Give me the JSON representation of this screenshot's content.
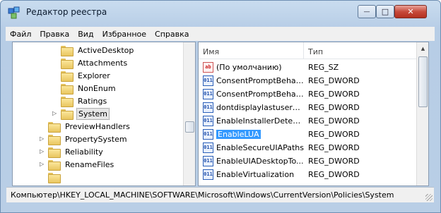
{
  "window": {
    "title": "Редактор реестра",
    "controls": {
      "minimize": "—",
      "maximize": "□",
      "close": "✕"
    }
  },
  "menu": [
    "Файл",
    "Правка",
    "Вид",
    "Избранное",
    "Справка"
  ],
  "tree": {
    "items": [
      {
        "label": "ActiveDesktop",
        "level": 2
      },
      {
        "label": "Attachments",
        "level": 2
      },
      {
        "label": "Explorer",
        "level": 2
      },
      {
        "label": "NonEnum",
        "level": 2
      },
      {
        "label": "Ratings",
        "level": 2
      },
      {
        "label": "System",
        "level": 2,
        "selected": true,
        "expander": "▷"
      },
      {
        "label": "PreviewHandlers",
        "level": 1
      },
      {
        "label": "PropertySystem",
        "level": 1,
        "expander": "▷"
      },
      {
        "label": "Reliability",
        "level": 1,
        "expander": "▷"
      },
      {
        "label": "RenameFiles",
        "level": 1,
        "expander": "▷"
      }
    ]
  },
  "list": {
    "columns": {
      "name": "Имя",
      "type": "Тип"
    },
    "rows": [
      {
        "icon": "ab",
        "name": "(По умолчанию)",
        "type": "REG_SZ"
      },
      {
        "icon": "011",
        "name": "ConsentPromptBehav...",
        "type": "REG_DWORD"
      },
      {
        "icon": "011",
        "name": "ConsentPromptBehav...",
        "type": "REG_DWORD"
      },
      {
        "icon": "011",
        "name": "dontdisplaylastuserna...",
        "type": "REG_DWORD"
      },
      {
        "icon": "011",
        "name": "EnableInstallerDetecti...",
        "type": "REG_DWORD"
      },
      {
        "icon": "011",
        "name": "EnableLUA",
        "type": "REG_DWORD",
        "selected": true
      },
      {
        "icon": "011",
        "name": "EnableSecureUIAPaths",
        "type": "REG_DWORD"
      },
      {
        "icon": "011",
        "name": "EnableUIADesktopTo...",
        "type": "REG_DWORD"
      },
      {
        "icon": "011",
        "name": "EnableVirtualization",
        "type": "REG_DWORD"
      }
    ]
  },
  "status": {
    "path": "Компьютер\\HKEY_LOCAL_MACHINE\\SOFTWARE\\Microsoft\\Windows\\CurrentVersion\\Policies\\System"
  },
  "colors": {
    "selection": "#3399ff",
    "chrome": "#b9cee6"
  }
}
